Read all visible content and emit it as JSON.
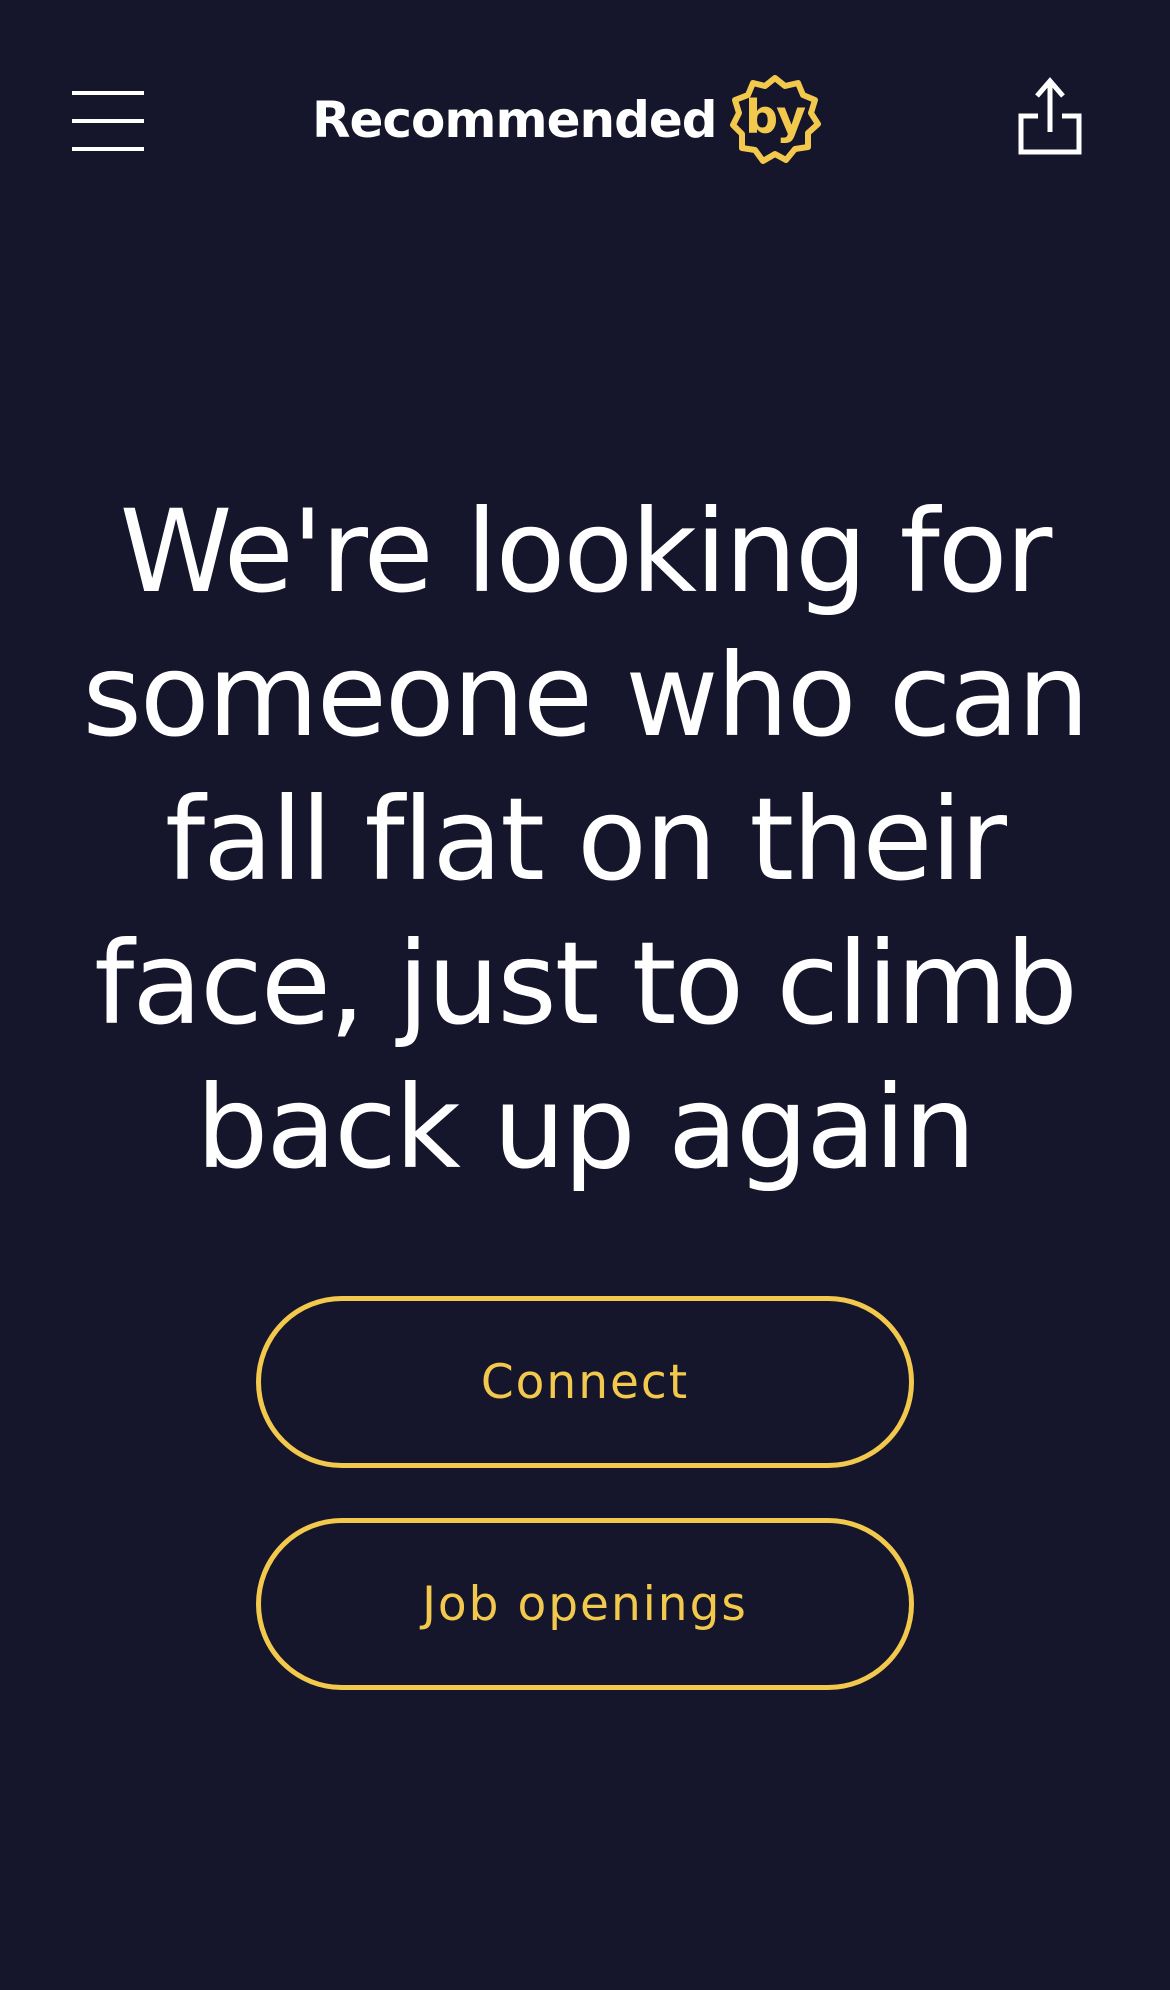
{
  "header": {
    "menu_icon": "hamburger-menu-icon",
    "logo": {
      "text": "Recommended",
      "badge_text": "by"
    },
    "share_icon": "share-icon"
  },
  "main": {
    "headline": "We're looking for someone who can fall flat on their face, just to climb back up again",
    "buttons": {
      "connect_label": "Connect",
      "jobs_label": "Job openings"
    }
  },
  "colors": {
    "background": "#15152b",
    "accent": "#f2c94c",
    "text": "#ffffff"
  }
}
